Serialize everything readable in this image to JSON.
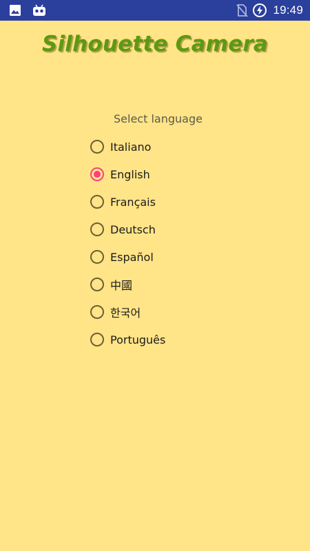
{
  "status_bar": {
    "time": "19:49",
    "background_color": "#2b3f9c",
    "icons": [
      "image-icon",
      "android-debug-icon",
      "no-sim-icon",
      "battery-charging-icon"
    ]
  },
  "app": {
    "title": "Silhouette Camera",
    "title_color": "#5c9a0f",
    "background_color": "#ffe488"
  },
  "language_select": {
    "label": "Select language",
    "accent_color": "#ff3f80",
    "selected": "English",
    "options": [
      {
        "label": "Italiano",
        "checked": false
      },
      {
        "label": "English",
        "checked": true
      },
      {
        "label": "Français",
        "checked": false
      },
      {
        "label": "Deutsch",
        "checked": false
      },
      {
        "label": "Español",
        "checked": false
      },
      {
        "label": "中國",
        "checked": false
      },
      {
        "label": "한국어",
        "checked": false
      },
      {
        "label": "Português",
        "checked": false
      }
    ]
  }
}
